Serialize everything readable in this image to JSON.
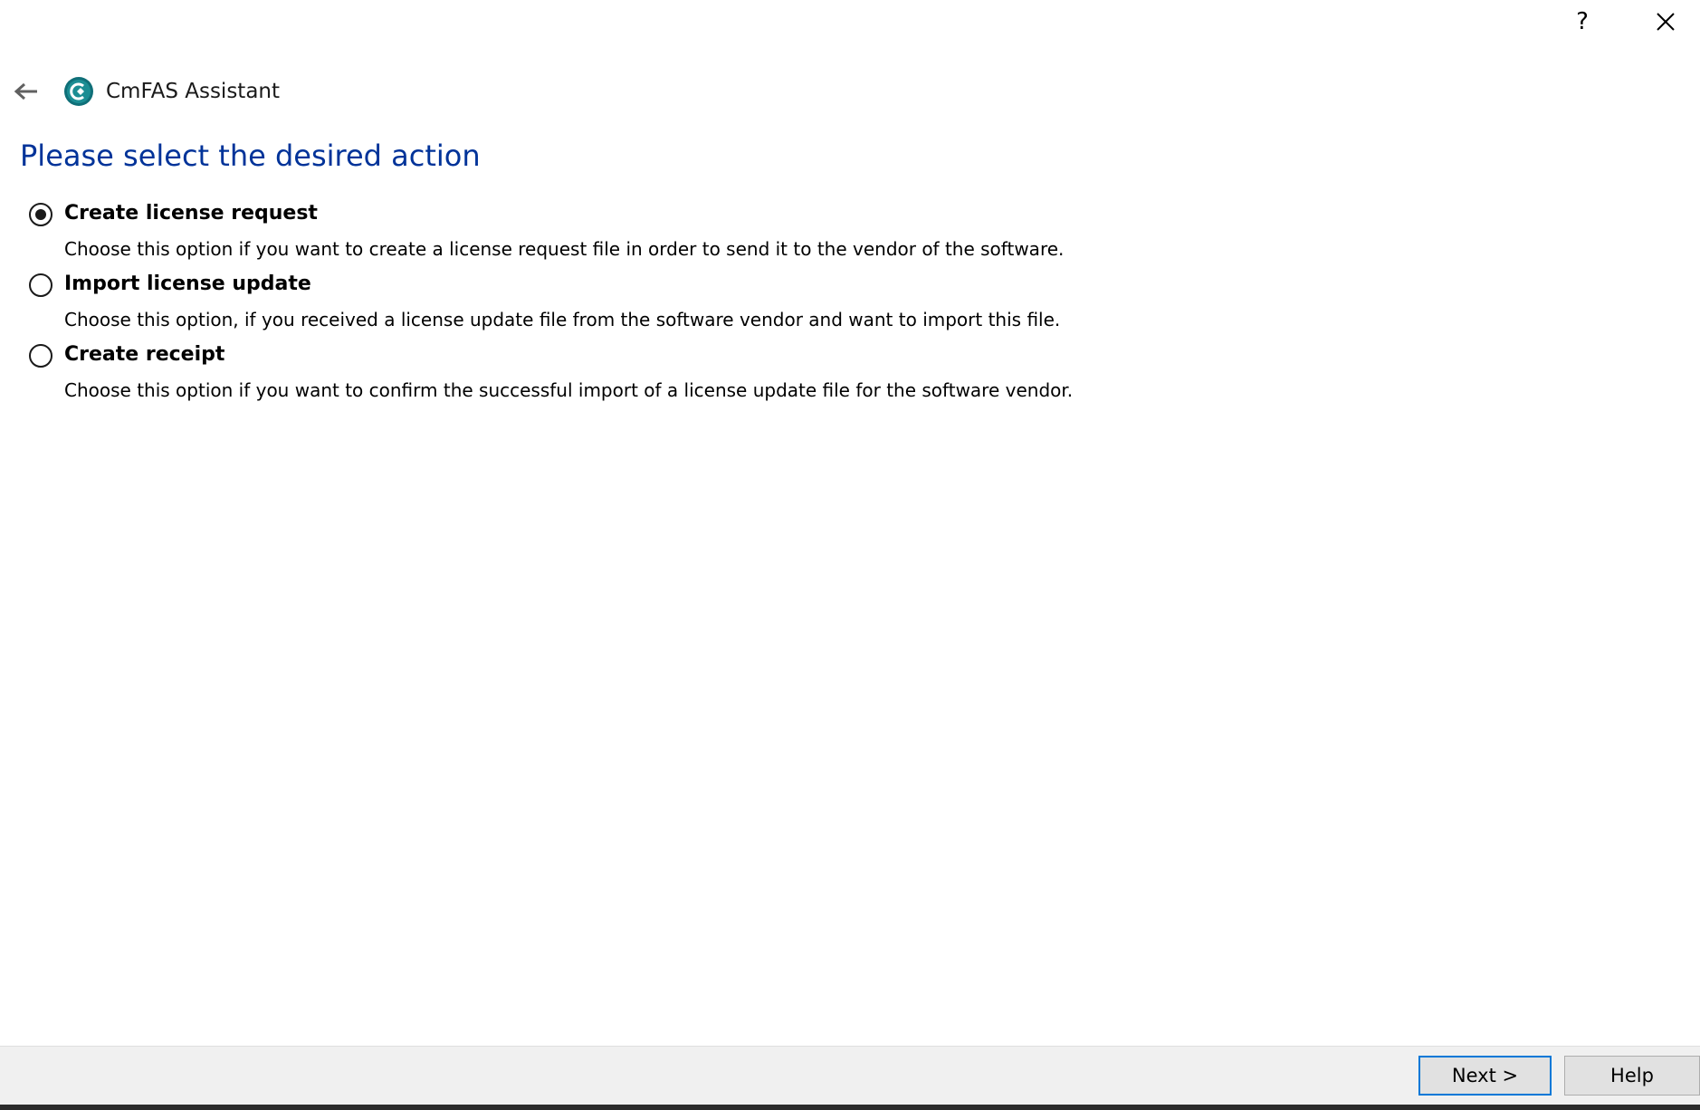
{
  "titlebar": {
    "help_label": "?",
    "close_icon": "close-icon"
  },
  "header": {
    "back_icon": "back-arrow-icon",
    "app_icon": "cmfas-logo-icon",
    "app_title": "CmFAS Assistant"
  },
  "main": {
    "heading": "Please select the desired action",
    "options": [
      {
        "label": "Create license request",
        "description": "Choose this option if you want to create a license request file in order to send it to the vendor of the software.",
        "selected": true
      },
      {
        "label": "Import license update",
        "description": "Choose this option, if you received a license update file from the software vendor and want to import this file.",
        "selected": false
      },
      {
        "label": "Create receipt",
        "description": "Choose this option if you want to confirm the successful import of a license update file for the software vendor.",
        "selected": false
      }
    ]
  },
  "footer": {
    "next_label": "Next >",
    "help_label": "Help"
  },
  "colors": {
    "heading": "#003399",
    "accent_border": "#0078d7",
    "footer_bg": "#f0f0f0",
    "logo": "#0f6f78"
  }
}
